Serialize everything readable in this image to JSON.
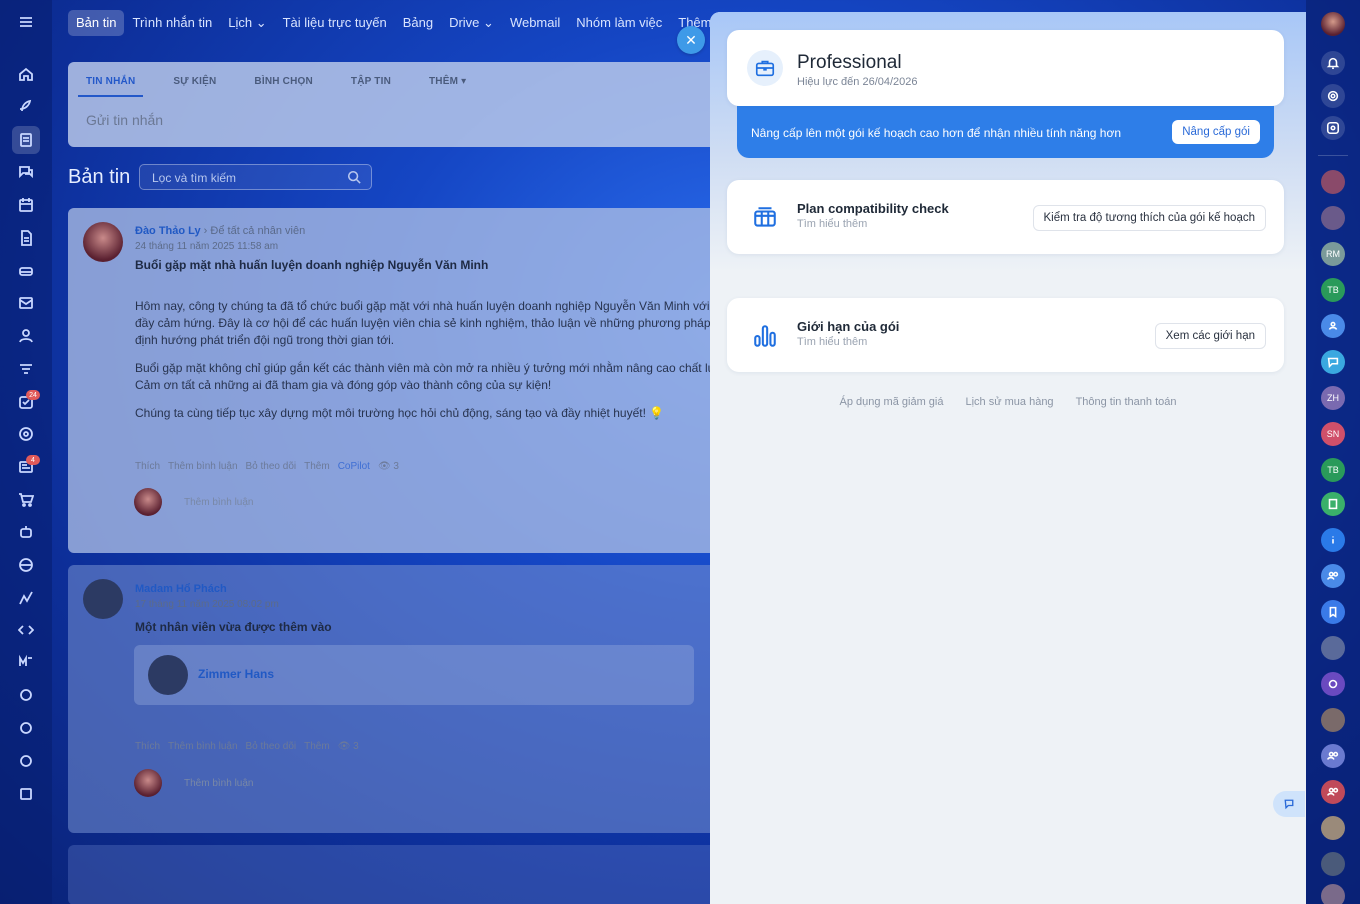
{
  "topnav": {
    "items": [
      "Bản tin",
      "Trình nhắn tin",
      "Lịch",
      "Tài liệu trực tuyến",
      "Bảng",
      "Drive",
      "Webmail",
      "Nhóm làm việc",
      "Thêm"
    ]
  },
  "left_rail": {
    "badges": [
      "24",
      "4"
    ]
  },
  "compose": {
    "tabs": [
      "TIN NHẮN",
      "SỰ KIỆN",
      "BÌNH CHỌN",
      "TẬP TIN",
      "THÊM"
    ],
    "placeholder": "Gửi tin nhắn"
  },
  "feed": {
    "title": "Bản tin",
    "search_placeholder": "Lọc và tìm kiếm"
  },
  "posts": [
    {
      "author": "Đào Thảo Ly",
      "to": "Để tất cả nhân viên",
      "date": "24 tháng 11 năm 2025 11:58 am",
      "heading": "Buổi gặp mặt nhà huấn luyện doanh nghiệp Nguyễn Văn Minh",
      "body": [
        "Hôm nay, công ty chúng ta đã tổ chức buổi gặp mặt với nhà huấn luyện doanh nghiệp Nguyễn Văn Minh với khôi",
        "đầy cảm hứng. Đây là cơ hội để các huấn luyện viên chia sẻ kinh nghiệm, thảo luận về những phương pháp đào",
        "định hướng phát triển đội ngũ trong thời gian tới.",
        "Buổi gặp mặt không chỉ giúp gắn kết các thành viên mà còn mở ra nhiều ý tưởng mới nhằm nâng cao chất lượng",
        "Cảm ơn tất cả những ai đã tham gia và đóng góp vào thành công của sự kiện!",
        "Chúng ta cùng tiếp tục xây dựng một môi trường học hỏi chủ động, sáng tạo và đầy nhiệt huyết! 💡"
      ],
      "actions": [
        "Thích",
        "Thêm bình luận",
        "Bỏ theo dõi",
        "Thêm",
        "CoPilot",
        "👁 3"
      ],
      "comment_placeholder": "Thêm bình luận"
    },
    {
      "author": "Madam Hổ Phách",
      "date": "17 tháng 11 năm 2025 08:02 pm",
      "heading": "Một nhân viên vừa được thêm vào",
      "employee": "Zimmer Hans",
      "actions": [
        "Thích",
        "Thêm bình luận",
        "Bỏ theo dõi",
        "Thêm",
        "👁 3"
      ],
      "comment_placeholder": "Thêm bình luận"
    }
  ],
  "panel": {
    "plan": {
      "name": "Professional",
      "valid_until": "Hiệu lực đến 26/04/2026"
    },
    "promo": {
      "text": "Nâng cấp lên một gói kế hoạch cao hơn để nhận nhiều tính năng hơn",
      "button": "Nâng cấp gói"
    },
    "compat": {
      "title": "Plan compatibility check",
      "sub": "Tìm hiểu thêm",
      "button": "Kiểm tra độ tương thích của gói kế hoạch"
    },
    "limits": {
      "title": "Giới hạn của gói",
      "sub": "Tìm hiểu thêm",
      "button": "Xem các giới hạn"
    },
    "footer_links": [
      "Áp dụng mã giảm giá",
      "Lịch sử mua hàng",
      "Thông tin thanh toán"
    ]
  },
  "right_rail": {
    "initials": [
      "RM",
      "TB",
      "ZH",
      "SN",
      "TB"
    ]
  },
  "colors": {
    "accent": "#2e7ee8",
    "panel_bg": "#eef2f6",
    "background": "#1546c4"
  }
}
